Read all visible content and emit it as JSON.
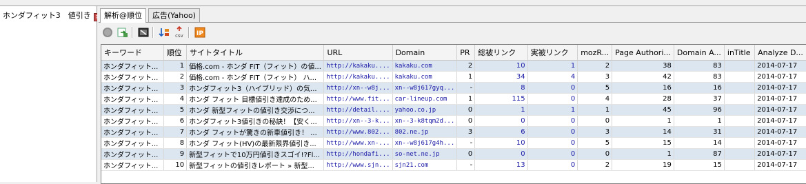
{
  "left_panel": {
    "tab_label": "ホンダフィット3　値引き",
    "close_glyph": "×"
  },
  "tabs": [
    {
      "label": "解析@順位",
      "active": true
    },
    {
      "label": "広告(Yahoo)",
      "active": false
    }
  ],
  "toolbar": {
    "buttons": [
      {
        "name": "stop-icon"
      },
      {
        "name": "export-icon"
      },
      {
        "name": "screen-icon"
      },
      {
        "name": "sort-icon"
      },
      {
        "name": "csv-export-icon",
        "glyph": "csv"
      },
      {
        "name": "ip-icon",
        "glyph": "IP"
      }
    ]
  },
  "table": {
    "columns": [
      "キーワード",
      "順位",
      "サイトタイトル",
      "URL",
      "Domain",
      "PR",
      "総被リンク",
      "実被リンク",
      "mozR...",
      "Page Authori...",
      "Domain A...",
      "inTitle",
      "Analyze D..."
    ],
    "rows": [
      [
        "ホンダフィット...",
        "1",
        "価格.com - ホンダ FIT（フィット）の値...",
        "http://kakaku....",
        "kakaku.com",
        "2",
        "10",
        "1",
        "2",
        "38",
        "83",
        "",
        "2014-07-17"
      ],
      [
        "ホンダフィット...",
        "2",
        "価格.com - ホンダ FIT（フィット） ハ...",
        "http://kakaku....",
        "kakaku.com",
        "1",
        "34",
        "4",
        "3",
        "42",
        "83",
        "",
        "2014-07-17"
      ],
      [
        "ホンダフィット...",
        "3",
        "ホンダフィット3（ハイブリッド）の気...",
        "http://xn--w8j...",
        "xn--w8j617gyq...",
        "-",
        "8",
        "0",
        "5",
        "16",
        "16",
        "",
        "2014-07-17"
      ],
      [
        "ホンダフィット...",
        "4",
        "ホンダ フィット 目標値引き達成のため...",
        "http://www.fit...",
        "car-lineup.com",
        "1",
        "115",
        "0",
        "4",
        "28",
        "37",
        "",
        "2014-07-17"
      ],
      [
        "ホンダフィット...",
        "5",
        "ホンダ 新型フィットの値引き交渉につ...",
        "http://detail....",
        "yahoo.co.jp",
        "0",
        "1",
        "1",
        "1",
        "45",
        "96",
        "",
        "2014-07-17"
      ],
      [
        "ホンダフィット...",
        "6",
        "ホンダフィット3値引きの秘訣！【安く...",
        "http://xn--3-k...",
        "xn--3-k8tqm2d...",
        "0",
        "0",
        "0",
        "0",
        "1",
        "1",
        "",
        "2014-07-17"
      ],
      [
        "ホンダフィット...",
        "7",
        "ホンダ フィットが驚きの新車値引き！ ...",
        "http://www.802...",
        "802.ne.jp",
        "3",
        "6",
        "0",
        "3",
        "14",
        "31",
        "",
        "2014-07-17"
      ],
      [
        "ホンダフィット...",
        "8",
        "ホンダ フィット(HV)の最新限界値引き...",
        "http://www.xn-...",
        "xn--w8j617g4h...",
        "-",
        "10",
        "0",
        "5",
        "15",
        "14",
        "",
        "2014-07-17"
      ],
      [
        "ホンダフィット...",
        "9",
        "新型フィットで10万円値引きスゴイ!?Fl...",
        "http://hondafi...",
        "so-net.ne.jp",
        "0",
        "0",
        "0",
        "0",
        "1",
        "87",
        "",
        "2014-07-17"
      ],
      [
        "ホンダフィット...",
        "10",
        "新型フィットの値引きレポート » 新型...",
        "http://www.sjn...",
        "sjn21.com",
        "-",
        "13",
        "0",
        "2",
        "19",
        "15",
        "",
        "2014-07-17"
      ]
    ]
  }
}
